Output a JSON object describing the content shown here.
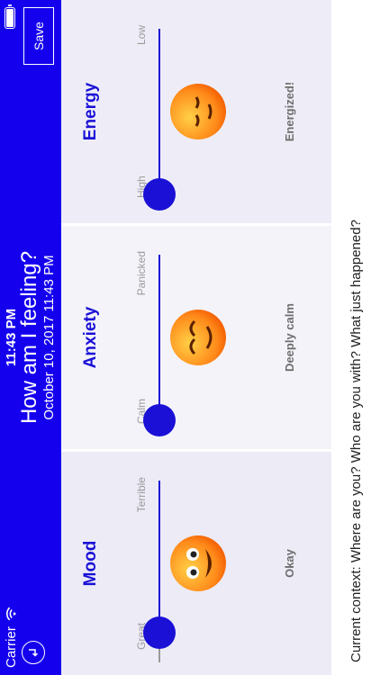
{
  "status_bar": {
    "carrier": "Carrier",
    "time": "11:43 PM"
  },
  "header": {
    "title": "How am I feeling?",
    "date": "October 10, 2017 11:43 PM",
    "save_label": "Save"
  },
  "panels": [
    {
      "id": "mood",
      "title": "Mood",
      "low_label": "Terrible",
      "high_label": "Great",
      "value_fraction": 0.92,
      "state_label": "Okay",
      "emoji": "grinning-face-wide-eyes"
    },
    {
      "id": "anxiety",
      "title": "Anxiety",
      "low_label": "Panicked",
      "high_label": "Calm",
      "value_fraction": 1.0,
      "state_label": "Deeply calm",
      "emoji": "smiling-face-closed-eyes"
    },
    {
      "id": "energy",
      "title": "Energy",
      "low_label": "Low",
      "high_label": "High",
      "value_fraction": 1.0,
      "state_label": "Energized!",
      "emoji": "relieved-face-closed-eyes"
    }
  ],
  "footer": {
    "context_prompt": "Current context: Where are you? Who are you with? What just happened?"
  },
  "colors": {
    "accent": "#1500ee",
    "panel_title": "#1a10d6",
    "emoji_gradient_top": "#ffb02e",
    "emoji_gradient_bottom": "#ff6a00"
  }
}
